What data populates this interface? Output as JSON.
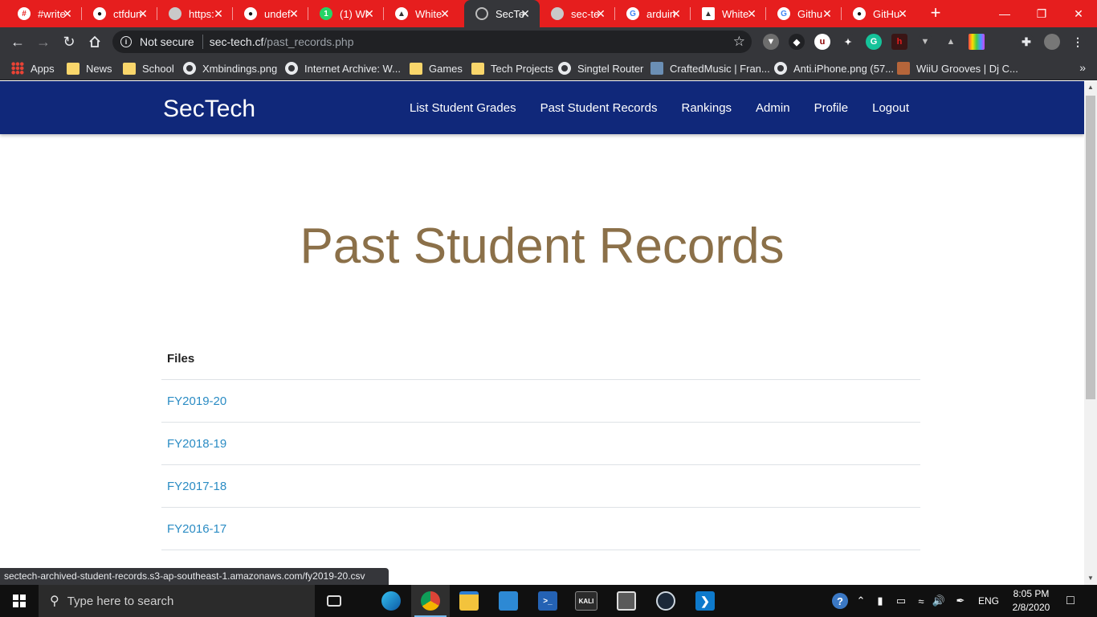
{
  "browser": {
    "tabs": [
      {
        "title": "#write",
        "favicon_icon": "writeup-favicon-icon"
      },
      {
        "title": "ctfdun",
        "favicon_icon": "github-icon"
      },
      {
        "title": "https:",
        "favicon_icon": "globe-icon"
      },
      {
        "title": "undef",
        "favicon_icon": "github-icon"
      },
      {
        "title": "(1) Wh",
        "favicon_icon": "whatsapp-icon"
      },
      {
        "title": "White",
        "favicon_icon": "site-favicon-icon"
      },
      {
        "title": "SecTe",
        "favicon_icon": "sectech-favicon-icon",
        "active": true
      },
      {
        "title": "sec-te",
        "favicon_icon": "globe-icon"
      },
      {
        "title": "arduin",
        "favicon_icon": "google-icon"
      },
      {
        "title": "White",
        "favicon_icon": "site-favicon-icon"
      },
      {
        "title": "Githu",
        "favicon_icon": "google-icon"
      },
      {
        "title": "GitHu",
        "favicon_icon": "github-icon"
      }
    ],
    "tab_close_glyph": "✕",
    "new_tab_glyph": "+",
    "window_controls": {
      "minimize": "—",
      "restore": "❐",
      "close": "✕"
    },
    "address": {
      "security_label": "Not secure",
      "host": "sec-tech.cf",
      "path": "/past_records.php"
    },
    "bookmarks": [
      {
        "label": "Apps",
        "icon": "apps-grid-icon"
      },
      {
        "label": "News",
        "icon": "folder-icon"
      },
      {
        "label": "School",
        "icon": "folder-icon"
      },
      {
        "label": "Xmbindings.png",
        "icon": "globe-icon"
      },
      {
        "label": "Internet Archive: W...",
        "icon": "globe-icon"
      },
      {
        "label": "Games",
        "icon": "folder-icon"
      },
      {
        "label": "Tech Projects",
        "icon": "folder-icon"
      },
      {
        "label": "Singtel Router",
        "icon": "globe-icon"
      },
      {
        "label": "CraftedMusic | Fran...",
        "icon": "site-favicon-icon"
      },
      {
        "label": "Anti.iPhone.png (57...",
        "icon": "globe-icon"
      },
      {
        "label": "WiiU Grooves | Dj C...",
        "icon": "site-favicon-icon"
      }
    ],
    "bookmarks_overflow": "»",
    "status_url": "sectech-archived-student-records.s3-ap-southeast-1.amazonaws.com/fy2019-20.csv"
  },
  "site": {
    "brand": "SecTech",
    "nav": [
      "List Student Grades",
      "Past Student Records",
      "Rankings",
      "Admin",
      "Profile",
      "Logout"
    ],
    "heading": "Past Student Records",
    "files_header": "Files",
    "files": [
      "FY2019-20",
      "FY2018-19",
      "FY2017-18",
      "FY2016-17"
    ]
  },
  "taskbar": {
    "search_placeholder": "Type here to search",
    "apps": [
      {
        "name": "task-view-icon"
      },
      {
        "name": "edge-icon"
      },
      {
        "name": "chrome-icon",
        "active": true
      },
      {
        "name": "file-explorer-icon"
      },
      {
        "name": "control-panel-icon"
      },
      {
        "name": "powershell-icon"
      },
      {
        "name": "kali-icon",
        "label": "KALI"
      },
      {
        "name": "snipping-tool-icon"
      },
      {
        "name": "steam-icon"
      },
      {
        "name": "vscode-icon"
      }
    ],
    "language": "ENG",
    "time": "8:05 PM",
    "date": "2/8/2020"
  },
  "colors": {
    "tabstrip": "#e61e1e",
    "site_nav": "#10287a",
    "heading": "#8b7049",
    "link": "#2b8cc4"
  }
}
